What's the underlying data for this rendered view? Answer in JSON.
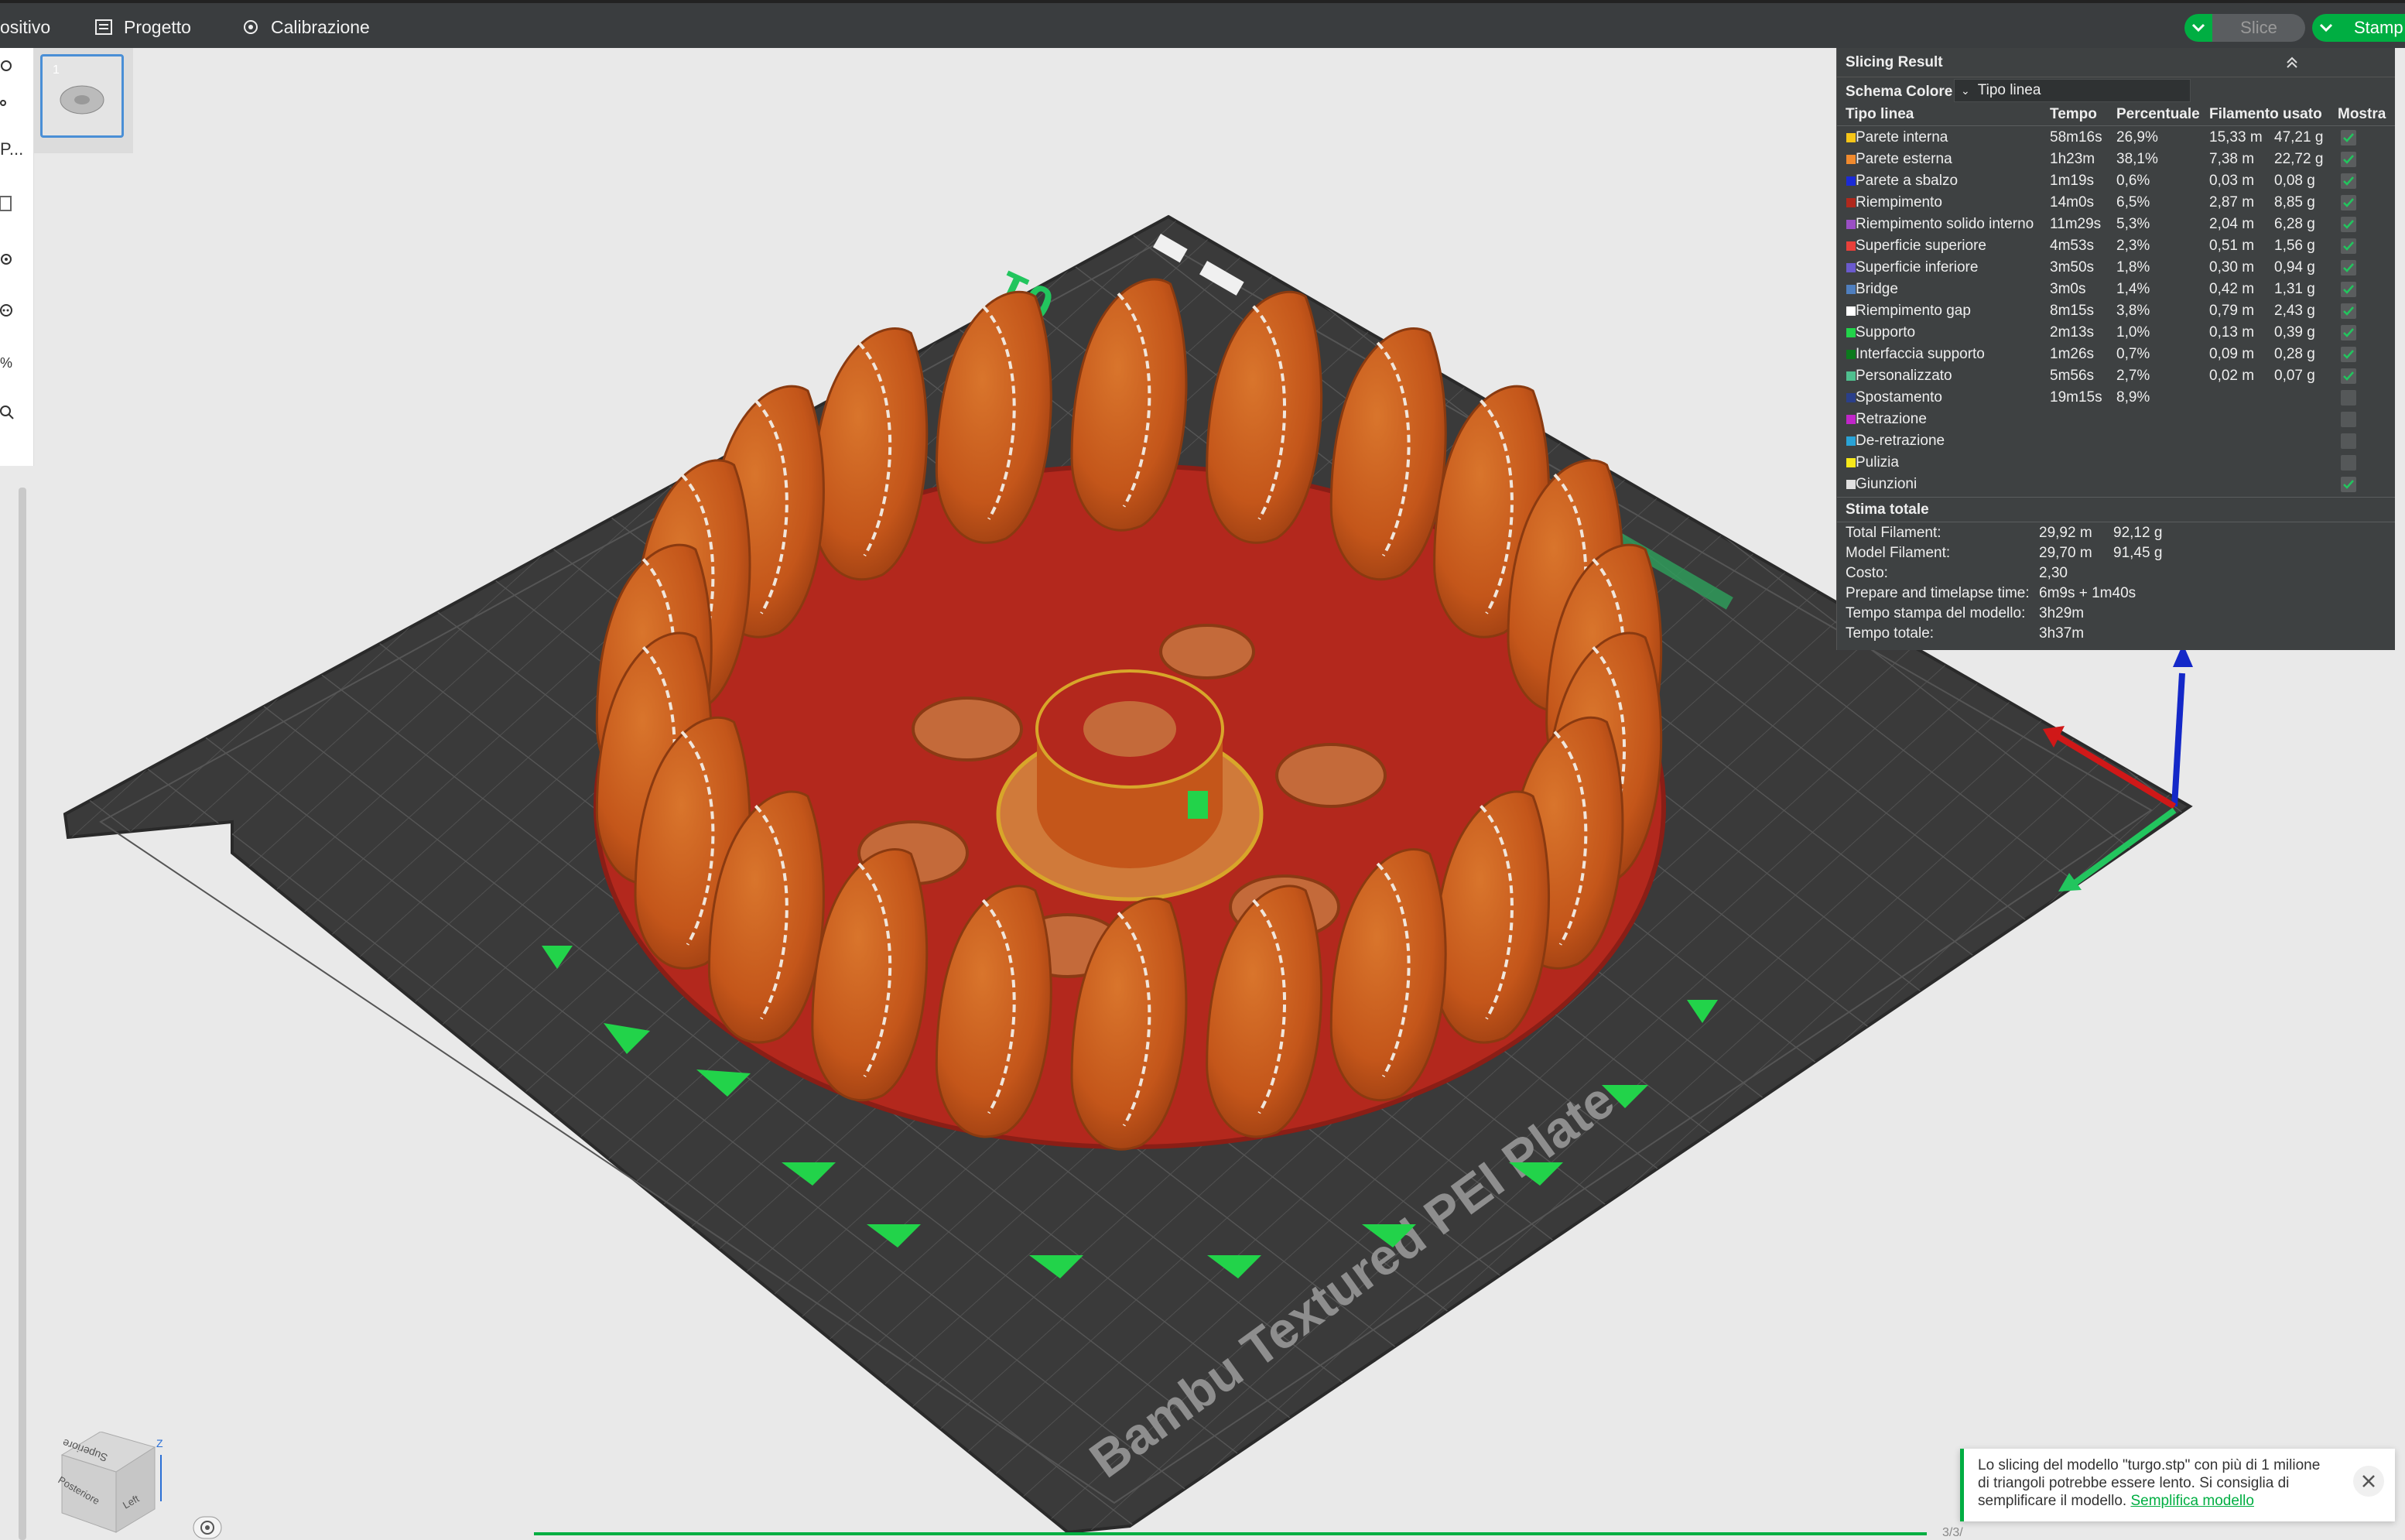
{
  "topbar": {
    "device_label": "ositivo",
    "project_label": "Progetto",
    "calibration_label": "Calibrazione",
    "slice_label": "Slice",
    "print_label": "Stamp"
  },
  "leftbar": {
    "truncated_text": "P..."
  },
  "plate": {
    "number_label": "01",
    "plate_name": "Bambu Textured PEI Plate",
    "thumbnail_index": "1"
  },
  "result": {
    "title": "Slicing Result",
    "schema_label": "Schema Colore",
    "schema_value": "Tipo linea",
    "columns": [
      "Tipo linea",
      "Tempo",
      "Percentuale",
      "Filamento usato",
      "Mostra"
    ],
    "rows": [
      {
        "name": "Parete interna",
        "color": "#f5c518",
        "time": "58m16s",
        "pct": "26,9%",
        "len": "15,33 m",
        "weight": "47,21 g",
        "show": true
      },
      {
        "name": "Parete esterna",
        "color": "#f08a2e",
        "time": "1h23m",
        "pct": "38,1%",
        "len": "7,38 m",
        "weight": "22,72 g",
        "show": true
      },
      {
        "name": "Parete a sbalzo",
        "color": "#1b2bd6",
        "time": "1m19s",
        "pct": "0,6%",
        "len": "0,03 m",
        "weight": "0,08 g",
        "show": true
      },
      {
        "name": "Riempimento",
        "color": "#b0281c",
        "time": "14m0s",
        "pct": "6,5%",
        "len": "2,87 m",
        "weight": "8,85 g",
        "show": true
      },
      {
        "name": "Riempimento solido interno",
        "color": "#9a4fc4",
        "time": "11m29s",
        "pct": "5,3%",
        "len": "2,04 m",
        "weight": "6,28 g",
        "show": true
      },
      {
        "name": "Superficie superiore",
        "color": "#e8403a",
        "time": "4m53s",
        "pct": "2,3%",
        "len": "0,51 m",
        "weight": "1,56 g",
        "show": true
      },
      {
        "name": "Superficie inferiore",
        "color": "#6a5acd",
        "time": "3m50s",
        "pct": "1,8%",
        "len": "0,30 m",
        "weight": "0,94 g",
        "show": true
      },
      {
        "name": "Bridge",
        "color": "#4f7fbf",
        "time": "3m0s",
        "pct": "1,4%",
        "len": "0,42 m",
        "weight": "1,31 g",
        "show": true
      },
      {
        "name": "Riempimento gap",
        "color": "#ffffff",
        "time": "8m15s",
        "pct": "3,8%",
        "len": "0,79 m",
        "weight": "2,43 g",
        "show": true
      },
      {
        "name": "Supporto",
        "color": "#22d34a",
        "time": "2m13s",
        "pct": "1,0%",
        "len": "0,13 m",
        "weight": "0,39 g",
        "show": true
      },
      {
        "name": "Interfaccia supporto",
        "color": "#0b7a1d",
        "time": "1m26s",
        "pct": "0,7%",
        "len": "0,09 m",
        "weight": "0,28 g",
        "show": true
      },
      {
        "name": "Personalizzato",
        "color": "#4fbf8f",
        "time": "5m56s",
        "pct": "2,7%",
        "len": "0,02 m",
        "weight": "0,07 g",
        "show": true
      },
      {
        "name": "Spostamento",
        "color": "#2a3f8a",
        "time": "19m15s",
        "pct": "8,9%",
        "len": "",
        "weight": "",
        "show": false
      },
      {
        "name": "Retrazione",
        "color": "#c026c9",
        "time": "",
        "pct": "",
        "len": "",
        "weight": "",
        "show": false
      },
      {
        "name": "De-retrazione",
        "color": "#2aa3d6",
        "time": "",
        "pct": "",
        "len": "",
        "weight": "",
        "show": false
      },
      {
        "name": "Pulizia",
        "color": "#f7e81a",
        "time": "",
        "pct": "",
        "len": "",
        "weight": "",
        "show": false
      },
      {
        "name": "Giunzioni",
        "color": "#e0e0e0",
        "time": "",
        "pct": "",
        "len": "",
        "weight": "",
        "show": true
      }
    ],
    "estimate_title": "Stima totale",
    "estimate": [
      {
        "label": "Total Filament:",
        "v1": "29,92 m",
        "v2": "92,12 g"
      },
      {
        "label": "Model Filament:",
        "v1": "29,70 m",
        "v2": "91,45 g"
      },
      {
        "label": "Costo:",
        "v1": "2,30",
        "v2": ""
      },
      {
        "label": "Prepare and timelapse time:",
        "v1": "6m9s + 1m40s",
        "v2": ""
      },
      {
        "label": "Tempo stampa del modello:",
        "v1": "3h29m",
        "v2": ""
      },
      {
        "label": "Tempo totale:",
        "v1": "3h37m",
        "v2": ""
      }
    ]
  },
  "toast": {
    "message": "Lo slicing del modello \"turgo.stp\" con più di 1 milione di triangoli potrebbe essere lento. Si consiglia di semplificare il modello.",
    "link": "Semplifica modello"
  },
  "viewcube": {
    "top_label": "Superiore",
    "back_label": "Posteriore",
    "left_label": "Left",
    "axis_label": "Z"
  },
  "progress": {
    "text": "3/3/"
  },
  "colors": {
    "accent": "#00ae42",
    "panel": "#3e4142",
    "bed": "#3b3b3b",
    "model": "#c85a1c",
    "infill": "#b0281c"
  }
}
